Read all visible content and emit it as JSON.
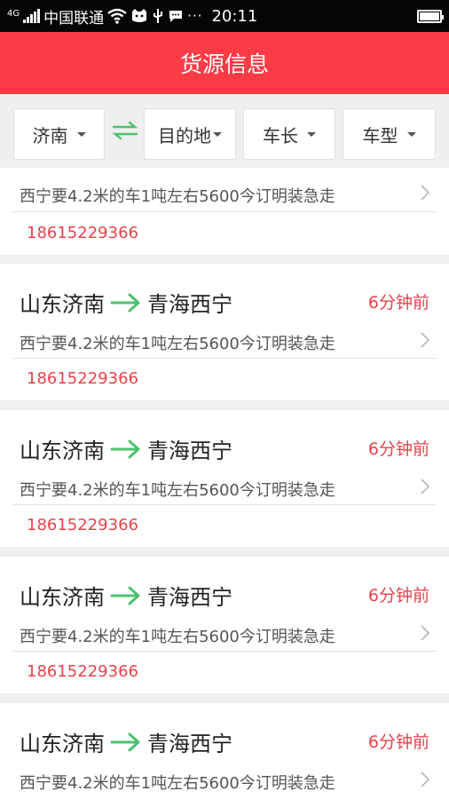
{
  "status_bar": {
    "net_type": "4G",
    "carrier": "中国联通",
    "time": "20:11",
    "icons": [
      "signal-icon",
      "wifi-icon",
      "cat-icon",
      "usb-icon",
      "chat-icon",
      "more-icon",
      "battery-icon"
    ]
  },
  "header": {
    "title": "货源信息"
  },
  "filters": {
    "origin": "济南",
    "destination": "目的地",
    "length": "车长",
    "vehicle_type": "车型",
    "swap_icon": "swap-arrows-icon",
    "accent_color": "#4cc26e"
  },
  "first_card": {
    "description": "西宁要4.2米的车1吨左右5600今订明装急走",
    "phone": "18615229366"
  },
  "cards": [
    {
      "from": "山东济南",
      "to": "青海西宁",
      "ago": "6分钟前",
      "description": "西宁要4.2米的车1吨左右5600今订明装急走",
      "phone": "18615229366"
    },
    {
      "from": "山东济南",
      "to": "青海西宁",
      "ago": "6分钟前",
      "description": "西宁要4.2米的车1吨左右5600今订明装急走",
      "phone": "18615229366"
    },
    {
      "from": "山东济南",
      "to": "青海西宁",
      "ago": "6分钟前",
      "description": "西宁要4.2米的车1吨左右5600今订明装急走",
      "phone": "18615229366"
    },
    {
      "from": "山东济南",
      "to": "青海西宁",
      "ago": "6分钟前",
      "description": "西宁要4.2米的车1吨左右5600今订明装急走"
    }
  ],
  "colors": {
    "header": "#fb3b45",
    "accent_red": "#e8424a",
    "arrow_green": "#4cc26e"
  }
}
